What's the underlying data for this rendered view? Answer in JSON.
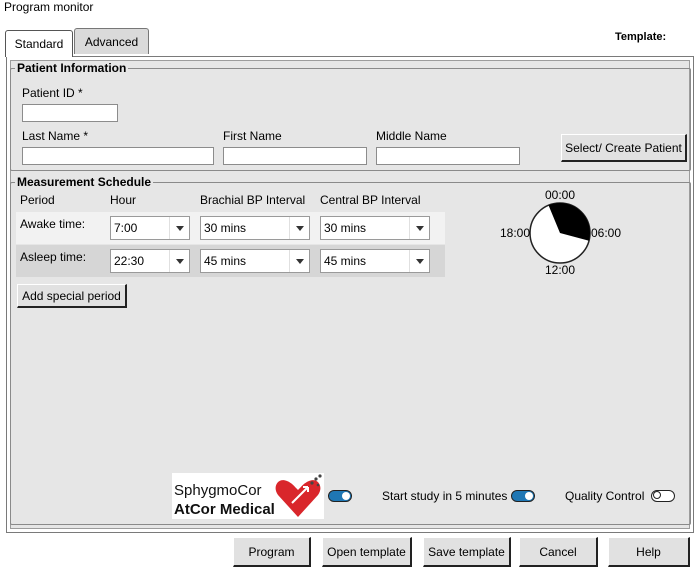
{
  "window": {
    "title": "Program monitor",
    "template_label": "Template:"
  },
  "tabs": [
    {
      "label": "Standard",
      "active": true
    },
    {
      "label": "Advanced",
      "active": false
    }
  ],
  "patient": {
    "legend": "Patient Information",
    "patient_id_label": "Patient ID *",
    "patient_id_value": "",
    "last_name_label": "Last Name *",
    "last_name_value": "",
    "first_name_label": "First Name",
    "first_name_value": "",
    "middle_name_label": "Middle Name",
    "middle_name_value": "",
    "select_button": "Select/ Create Patient"
  },
  "schedule": {
    "legend": "Measurement Schedule",
    "headers": [
      "Period",
      "Hour",
      "Brachial BP Interval",
      "Central BP Interval"
    ],
    "rows": [
      {
        "period": "Awake time:",
        "hour": "7:00",
        "brachial": "30 mins",
        "central": "30 mins"
      },
      {
        "period": "Asleep time:",
        "hour": "22:30",
        "brachial": "45 mins",
        "central": "45 mins"
      }
    ],
    "add_special_button": "Add special period",
    "clock": {
      "top": "00:00",
      "right": "06:00",
      "bottom": "12:00",
      "left": "18:00",
      "sleep_start_hour": 22.5,
      "sleep_end_hour": 7.0,
      "fill_color": "#000000"
    }
  },
  "logo": {
    "line1": "SphygmoCor",
    "line2": "AtCor Medical",
    "accent_color": "#d9262b"
  },
  "toggles": {
    "logo_toggle": {
      "on": true
    },
    "start_study": {
      "label": "Start study in 5 minutes",
      "on": true
    },
    "quality_control": {
      "label": "Quality Control",
      "on": false
    }
  },
  "footer": {
    "buttons": [
      "Program",
      "Open template",
      "Save template",
      "Cancel",
      "Help"
    ]
  },
  "colors": {
    "accent": "#1f77b4",
    "panel_bg": "#e6e6e6"
  }
}
